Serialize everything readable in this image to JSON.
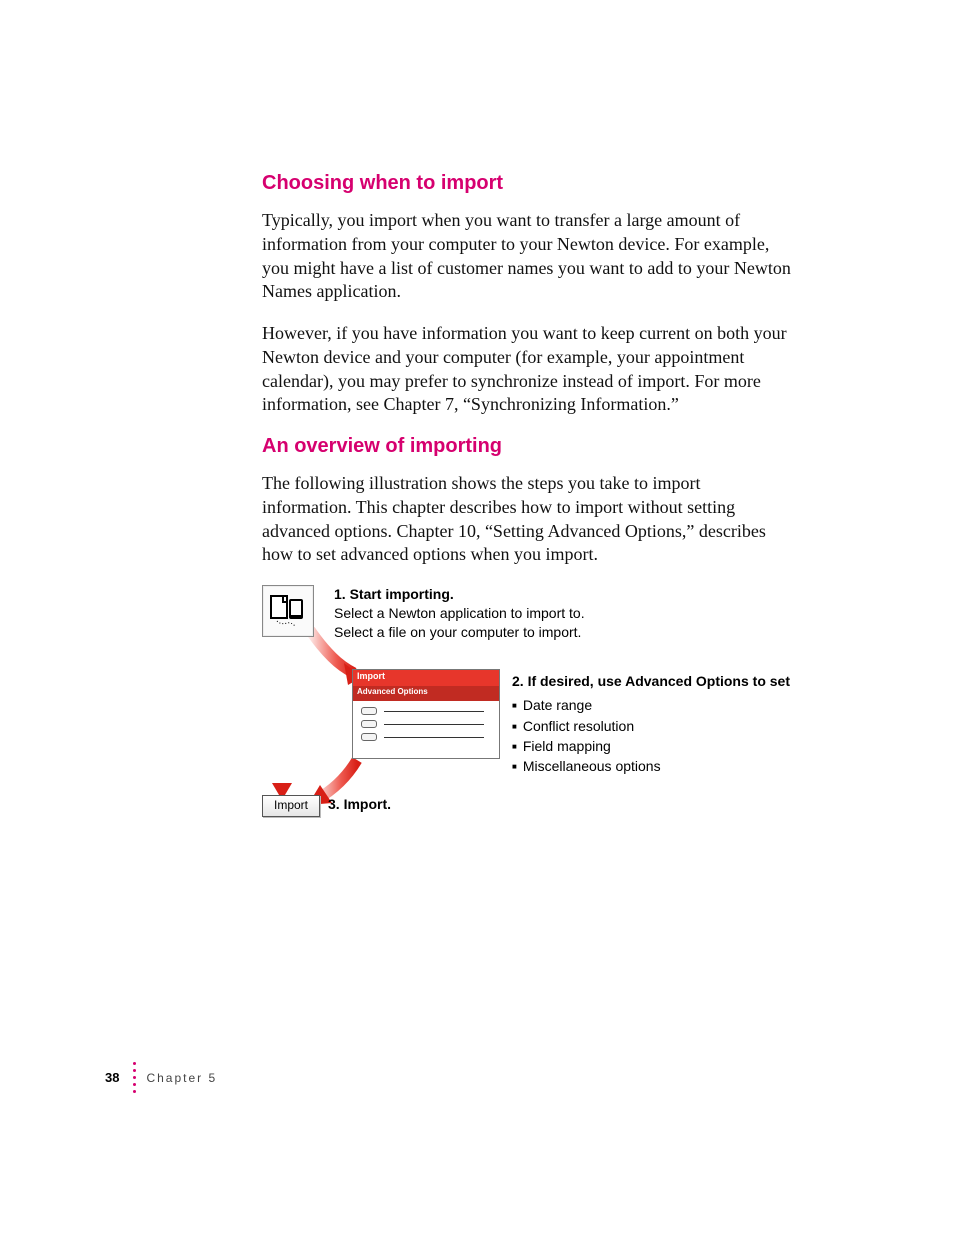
{
  "headings": {
    "h1": "Choosing when to import",
    "h2": "An overview of importing"
  },
  "paragraphs": {
    "p1": "Typically, you import when you want to transfer a large amount of information from your computer to your Newton device. For example, you might have a list of customer names you want to add to your Newton Names application.",
    "p2": "However, if you have information you want to keep current on both your Newton device and your computer (for example, your appointment calendar), you may prefer to synchronize instead of import. For more information, see Chapter 7, “Synchronizing Information.”",
    "p3": "The following illustration shows the steps you take to import information. This chapter describes how to import without setting advanced options. Chapter 10, “Setting Advanced Options,” describes how to set advanced options when you import."
  },
  "diagram": {
    "step1_title": "1. Start importing.",
    "step1_line1": "Select a Newton application to import to.",
    "step1_line2": "Select a file on your computer to import.",
    "box_title": "Import",
    "box_sub": "Advanced Options",
    "step2_title": "2. If desired, use Advanced Options to set",
    "step2_items": {
      "a": "Date range",
      "b": "Conflict resolution",
      "c": "Field mapping",
      "d": "Miscellaneous options"
    },
    "import_button": "Import",
    "step3": "3. Import."
  },
  "footer": {
    "page_num": "38",
    "chapter": "Chapter 5"
  }
}
